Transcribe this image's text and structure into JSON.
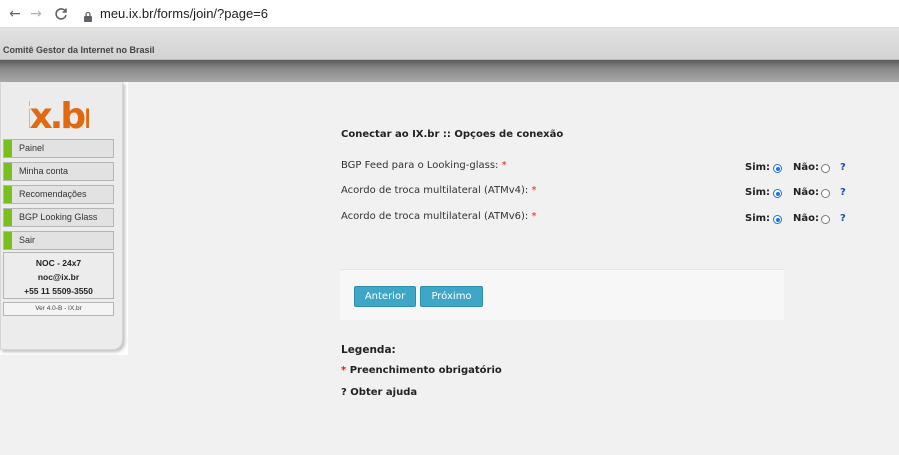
{
  "browser": {
    "back_icon": "←",
    "forward_icon": "→",
    "reload_icon": "C",
    "url": "meu.ix.br/forms/join/?page=6"
  },
  "site": {
    "title": "Comitê Gestor da Internet no Brasil"
  },
  "sidebar": {
    "logo_text": "ix.br",
    "items": [
      {
        "label": "Painel"
      },
      {
        "label": "Minha conta"
      },
      {
        "label": "Recomendações"
      },
      {
        "label": "BGP Looking Glass"
      },
      {
        "label": "Sair"
      }
    ],
    "noc": {
      "title": "NOC - 24x7",
      "email": "noc@ix.br",
      "phone": "+55 11 5509-3550"
    },
    "version": "Ver 4.0-B - IX.br"
  },
  "form": {
    "title": "Conectar ao IX.br :: Opçoes de conexão",
    "yes_label": "Sim:",
    "no_label": "Não:",
    "help_label": "?",
    "required_mark": "*",
    "rows": [
      {
        "label": "BGP Feed para o Looking-glass:",
        "selected": "Sim"
      },
      {
        "label": "Acordo de troca multilateral (ATMv4):",
        "selected": "Sim"
      },
      {
        "label": "Acordo de troca multilateral (ATMv6):",
        "selected": "Sim"
      }
    ],
    "buttons": {
      "previous": "Anterior",
      "next": "Próximo"
    }
  },
  "legend": {
    "title": "Legenda:",
    "required_mark": "*",
    "required_text": "Preenchimento obrigatório",
    "help_mark": "?",
    "help_text": "Obter ajuda"
  },
  "colors": {
    "accent_button": "#3ea7c8",
    "menu_marker": "#7bbf1e",
    "required": "#d9201b",
    "help": "#1a4fb0",
    "logo": "#e06a12"
  }
}
